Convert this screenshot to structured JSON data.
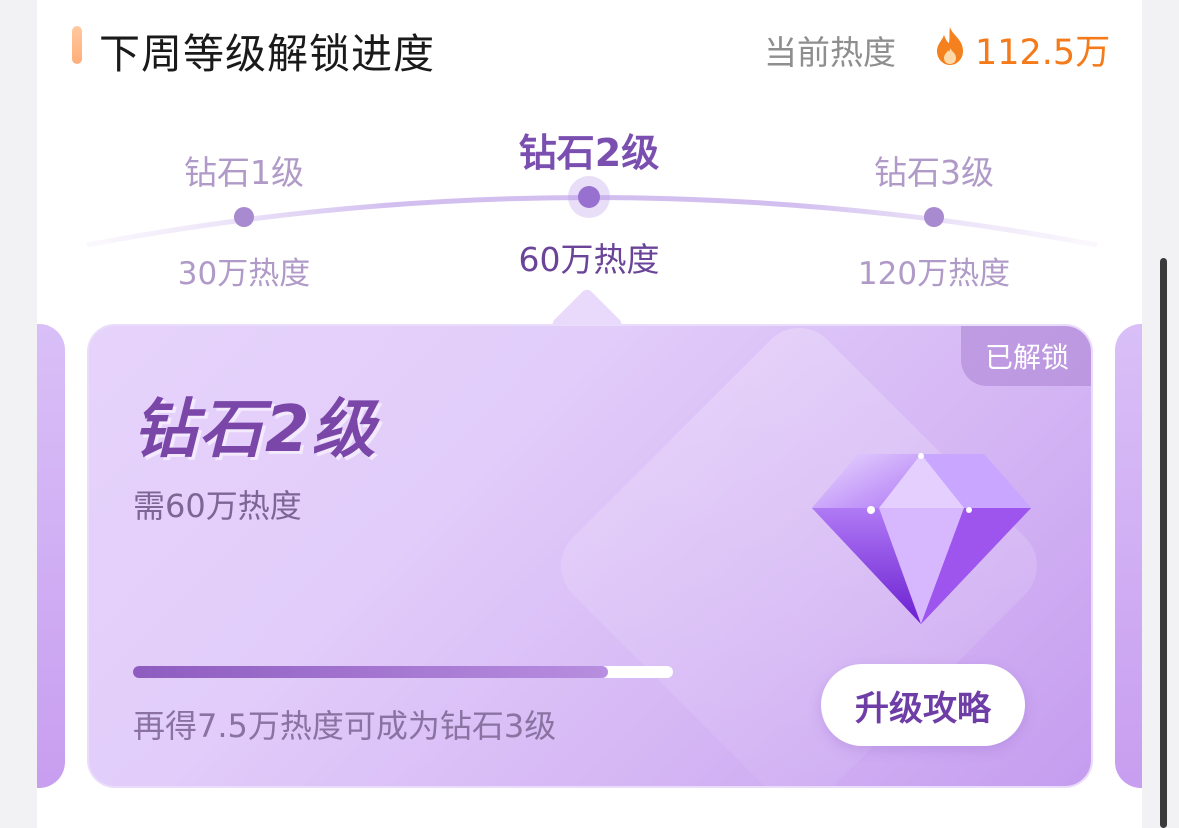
{
  "header": {
    "title": "下周等级解锁进度",
    "current_heat_label": "当前热度",
    "current_heat_value": "112.5万",
    "fire_icon": "fire-icon"
  },
  "tiers": [
    {
      "name": "钻石1级",
      "heat": "30万热度"
    },
    {
      "name": "钻石2级",
      "heat": "60万热度"
    },
    {
      "name": "钻石3级",
      "heat": "120万热度"
    }
  ],
  "active_tier_index": 1,
  "card": {
    "status_badge": "已解锁",
    "level_title": "钻石2级",
    "requirement": "需60万热度",
    "gem_icon": "diamond-gem-icon",
    "progress_fraction": 0.88,
    "hint": "再得7.5万热度可成为钻石3级",
    "guide_button": "升级攻略"
  },
  "colors": {
    "accent_orange": "#f47a1a",
    "purple_dark": "#7a4fb0",
    "purple_light": "#b09ac8"
  }
}
